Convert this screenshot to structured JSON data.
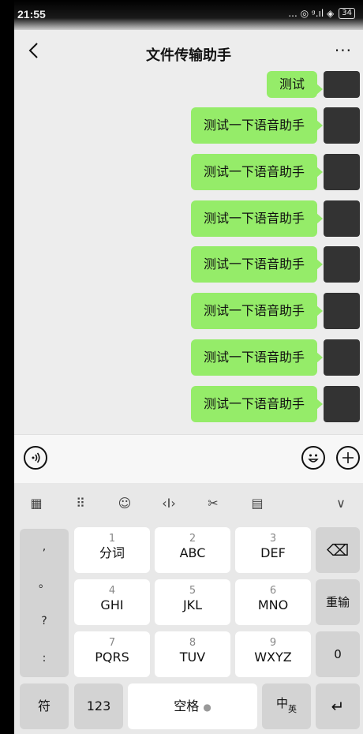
{
  "status": {
    "time": "21:55",
    "icons": "... ◎ ᵍ.ıl ◈",
    "battery": "34"
  },
  "header": {
    "title": "文件传输助手",
    "more": "···"
  },
  "messages": [
    {
      "text": "测试"
    },
    {
      "text": "测试一下语音助手"
    },
    {
      "text": "测试一下语音助手"
    },
    {
      "text": "测试一下语音助手"
    },
    {
      "text": "测试一下语音助手"
    },
    {
      "text": "测试一下语音助手"
    },
    {
      "text": "测试一下语音助手"
    },
    {
      "text": "测试一下语音助手"
    }
  ],
  "keyboard": {
    "tools": [
      "▦",
      "⠿",
      "☺",
      "‹I›",
      "✂",
      "▤",
      "∨"
    ],
    "side": [
      ",",
      "。",
      "?",
      ":"
    ],
    "keys": [
      {
        "num": "1",
        "letters": "分词"
      },
      {
        "num": "2",
        "letters": "ABC"
      },
      {
        "num": "3",
        "letters": "DEF"
      },
      {
        "num": "4",
        "letters": "GHI"
      },
      {
        "num": "5",
        "letters": "JKL"
      },
      {
        "num": "6",
        "letters": "MNO"
      },
      {
        "num": "7",
        "letters": "PQRS"
      },
      {
        "num": "8",
        "letters": "TUV"
      },
      {
        "num": "9",
        "letters": "WXYZ"
      }
    ],
    "backspace": "⌫",
    "reinput": "重输",
    "zero": "0",
    "symbol": "符",
    "num123": "123",
    "space": "空格",
    "mic": "●",
    "lang_main": "中",
    "lang_sub": "英",
    "enter": "↵"
  },
  "colors": {
    "bubble": "#95ec69",
    "chat_bg": "#ededed"
  }
}
